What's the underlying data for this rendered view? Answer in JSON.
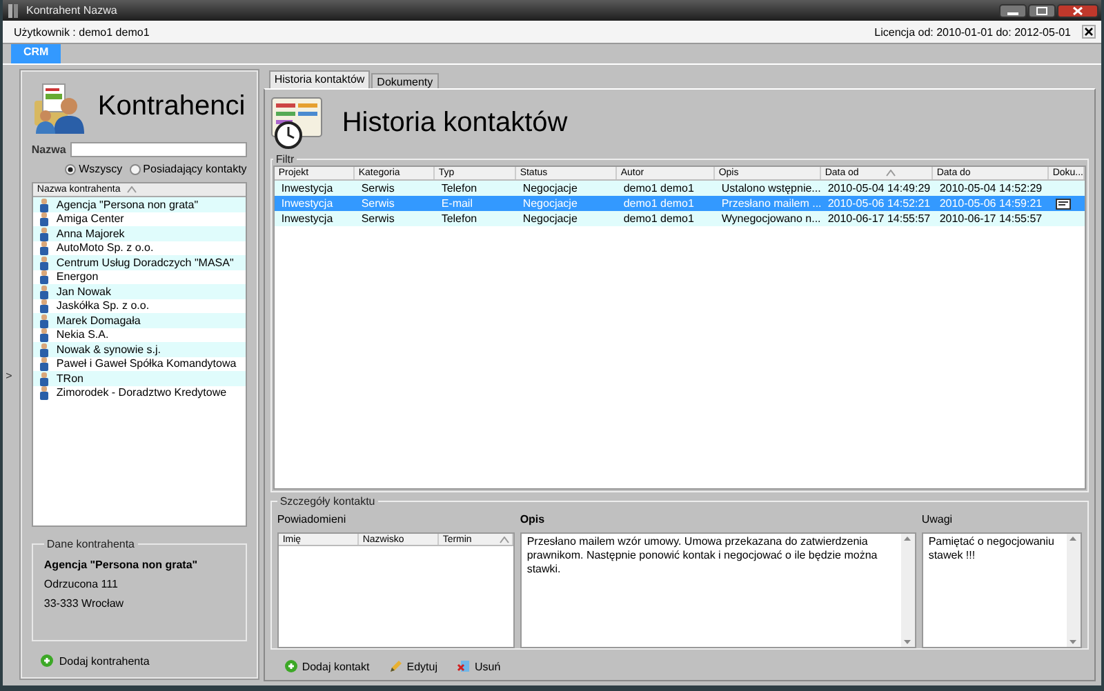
{
  "window": {
    "title": "Kontrahent Nazwa"
  },
  "info_bar": {
    "user": "Użytkownik : demo1 demo1",
    "license": "Licencja od: 2010-01-01 do: 2012-05-01"
  },
  "main_tabs": [
    {
      "label": "CRM",
      "selected": true
    }
  ],
  "side_toggle": ">",
  "contractors": {
    "title": "Kontrahenci",
    "search_label": "Nazwa",
    "filters": [
      {
        "label": "Wszyscy",
        "selected": true
      },
      {
        "label": "Posiadający kontakty",
        "selected": false
      }
    ],
    "list": {
      "column": "Nazwa kontrahenta",
      "sorted": true,
      "items": [
        {
          "name": "Agencja \"Persona non grata\""
        },
        {
          "name": "Amiga Center"
        },
        {
          "name": "Anna Majorek"
        },
        {
          "name": "AutoMoto Sp. z o.o."
        },
        {
          "name": "Centrum Usług Doradczych \"MASA\""
        },
        {
          "name": "Energon"
        },
        {
          "name": "Jan Nowak"
        },
        {
          "name": "Jaskółka Sp. z o.o."
        },
        {
          "name": "Marek Domagała"
        },
        {
          "name": "Nekia S.A."
        },
        {
          "name": "Nowak & synowie s.j."
        },
        {
          "name": "Paweł i Gaweł Spółka Komandytowa"
        },
        {
          "name": "TRon"
        },
        {
          "name": "Zimorodek - Doradztwo Kredytowe"
        }
      ]
    },
    "details": {
      "legend": "Dane kontrahenta",
      "name": "Agencja \"Persona non grata\"",
      "street": "Odrzucona 111",
      "city": "33-333 Wrocław"
    },
    "add_button": "Dodaj kontrahenta"
  },
  "history": {
    "tabs": [
      {
        "label": "Historia kontaktów",
        "selected": true
      },
      {
        "label": "Dokumenty",
        "selected": false
      }
    ],
    "title": "Historia kontaktów",
    "filter_legend": "Filtr",
    "table": {
      "columns": [
        {
          "label": "Projekt",
          "sorted": false
        },
        {
          "label": "Kategoria",
          "sorted": false
        },
        {
          "label": "Typ",
          "sorted": false
        },
        {
          "label": "Status",
          "sorted": false
        },
        {
          "label": "Autor",
          "sorted": false
        },
        {
          "label": "Opis",
          "sorted": false
        },
        {
          "label": "Data od",
          "sorted": true
        },
        {
          "label": "Data do",
          "sorted": false
        },
        {
          "label": "Doku...",
          "sorted": false
        }
      ],
      "rows": [
        {
          "cells": [
            "Inwestycja",
            "Serwis",
            "Telefon",
            "Negocjacje",
            "demo1 demo1",
            "Ustalono wstępnie...",
            "2010-05-04 14:49:29",
            "2010-05-04 14:52:29"
          ],
          "has_document": false,
          "selected": false
        },
        {
          "cells": [
            "Inwestycja",
            "Serwis",
            "E-mail",
            "Negocjacje",
            "demo1 demo1",
            "Przesłano mailem ...",
            "2010-05-06 14:52:21",
            "2010-05-06 14:59:21"
          ],
          "has_document": true,
          "selected": true
        },
        {
          "cells": [
            "Inwestycja",
            "Serwis",
            "Telefon",
            "Negocjacje",
            "demo1 demo1",
            "Wynegocjowano n...",
            "2010-06-17 14:55:57",
            "2010-06-17 14:55:57"
          ],
          "has_document": false,
          "selected": false
        }
      ]
    }
  },
  "contact_details": {
    "legend": "Szczegóły kontaktu",
    "notified": {
      "label": "Powiadomieni",
      "columns": [
        {
          "label": "Imię",
          "sorted": false
        },
        {
          "label": "Nazwisko",
          "sorted": false
        },
        {
          "label": "Termin",
          "sorted": true
        }
      ]
    },
    "description": {
      "label": "Opis",
      "text": "Przesłano mailem wzór umowy. Umowa przekazana do zatwierdzenia prawnikom. Następnie ponowić kontak i negocjować o ile będzie można stawki."
    },
    "notes": {
      "label": "Uwagi",
      "text": "Pamiętać o negocjowaniu stawek !!!"
    }
  },
  "actions": [
    {
      "kind": "add",
      "label": "Dodaj kontakt"
    },
    {
      "kind": "edit",
      "label": "Edytuj"
    },
    {
      "kind": "delete",
      "label": "Usuń"
    }
  ]
}
